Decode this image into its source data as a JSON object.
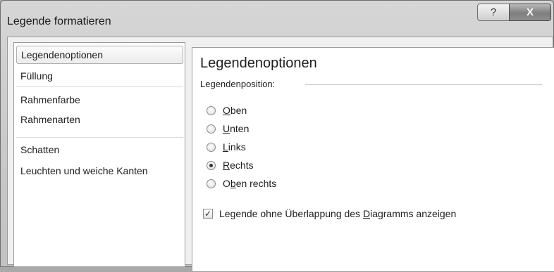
{
  "window": {
    "title": "Legende formatieren",
    "help_symbol": "?",
    "close_symbol": "X"
  },
  "sidebar": {
    "items": [
      {
        "label": "Legendenoptionen",
        "selected": true
      },
      {
        "label": "Füllung"
      },
      {
        "label": "Rahmenfarbe"
      },
      {
        "label": "Rahmenarten"
      },
      {
        "label": "Schatten"
      },
      {
        "label": "Leuchten und weiche Kanten"
      }
    ]
  },
  "panel": {
    "title": "Legendenoptionen",
    "position_label": "Legendenposition:",
    "options": [
      {
        "pre": "",
        "key": "O",
        "post": "ben",
        "checked": false
      },
      {
        "pre": "",
        "key": "U",
        "post": "nten",
        "checked": false
      },
      {
        "pre": "",
        "key": "L",
        "post": "inks",
        "checked": false
      },
      {
        "pre": "",
        "key": "R",
        "post": "echts",
        "checked": true
      },
      {
        "pre": "O",
        "key": "b",
        "post": "en rechts",
        "checked": false
      }
    ],
    "overlap_checkbox": {
      "pre": "Legende ohne Überlappung des ",
      "key": "D",
      "post": "iagramms anzeigen",
      "checked": true,
      "check_glyph": "✓"
    }
  }
}
